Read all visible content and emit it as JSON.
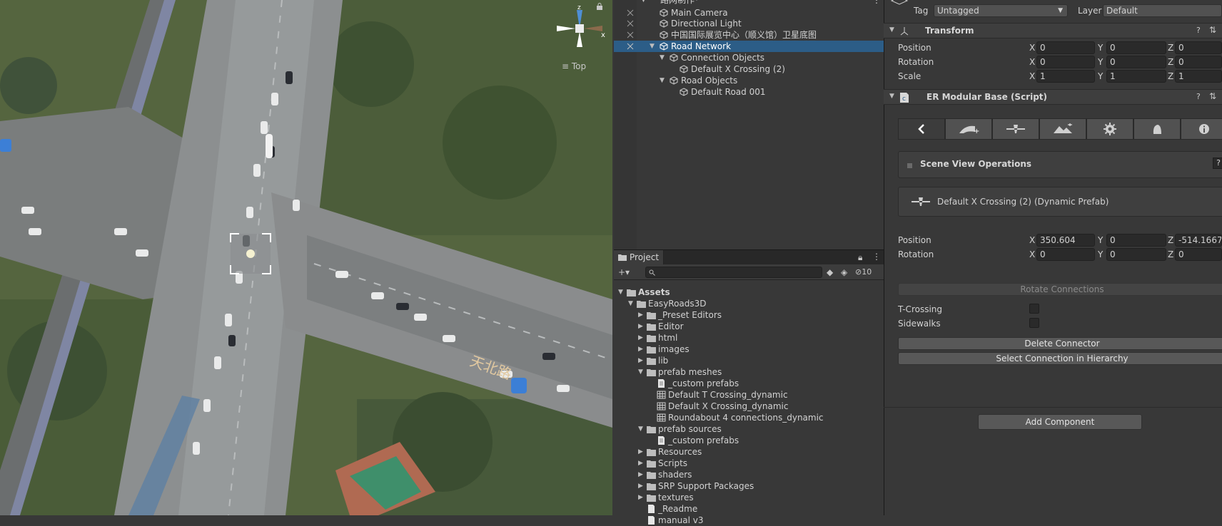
{
  "scene": {
    "gizmo_axes": {
      "z": "z",
      "x": "x"
    },
    "view_label": "Top",
    "map_text": "天北路"
  },
  "hierarchy": {
    "scene_name": "路网制作*",
    "items": [
      {
        "label": "Main Camera",
        "selected": false
      },
      {
        "label": "Directional Light",
        "selected": false
      },
      {
        "label": "中国国际展览中心（顺义馆）卫星底图",
        "selected": false
      },
      {
        "label": "Road Network",
        "selected": true
      },
      {
        "label": "Connection Objects",
        "selected": false
      },
      {
        "label": "Default X Crossing (2)",
        "selected": false
      },
      {
        "label": "Road Objects",
        "selected": false
      },
      {
        "label": "Default Road 001",
        "selected": false
      }
    ]
  },
  "project": {
    "tab_label": "Project",
    "add_label": "+▾",
    "hidden_count": "10",
    "items": [
      {
        "label": "Assets",
        "type": "folder",
        "bold": true
      },
      {
        "label": "EasyRoads3D",
        "type": "folder"
      },
      {
        "label": "_Preset Editors",
        "type": "folder"
      },
      {
        "label": "Editor",
        "type": "folder"
      },
      {
        "label": "html",
        "type": "folder"
      },
      {
        "label": "images",
        "type": "folder"
      },
      {
        "label": "lib",
        "type": "folder"
      },
      {
        "label": "prefab meshes",
        "type": "folder"
      },
      {
        "label": "_custom prefabs",
        "type": "file"
      },
      {
        "label": "Default T Crossing_dynamic",
        "type": "mesh"
      },
      {
        "label": "Default X Crossing_dynamic",
        "type": "mesh"
      },
      {
        "label": "Roundabout 4 connections_dynamic",
        "type": "mesh"
      },
      {
        "label": "prefab sources",
        "type": "folder"
      },
      {
        "label": "_custom prefabs",
        "type": "file"
      },
      {
        "label": "Resources",
        "type": "folder"
      },
      {
        "label": "Scripts",
        "type": "folder"
      },
      {
        "label": "shaders",
        "type": "folder"
      },
      {
        "label": "SRP Support Packages",
        "type": "folder"
      },
      {
        "label": "textures",
        "type": "folder"
      },
      {
        "label": "_Readme",
        "type": "file"
      },
      {
        "label": "manual v3",
        "type": "file"
      }
    ]
  },
  "inspector": {
    "tag_label": "Tag",
    "tag_value": "Untagged",
    "layer_label": "Layer",
    "layer_value": "Default",
    "transform": {
      "title": "Transform",
      "position_label": "Position",
      "rotation_label": "Rotation",
      "scale_label": "Scale",
      "position": {
        "x": "0",
        "y": "0",
        "z": "0"
      },
      "rotation": {
        "x": "0",
        "y": "0",
        "z": "0"
      },
      "scale": {
        "x": "1",
        "y": "1",
        "z": "1"
      }
    },
    "script": {
      "title": "ER Modular Base (Script)",
      "scene_ops_label": "Scene View Operations",
      "prefab_name": "Default X Crossing (2)",
      "prefab_type": "(Dynamic Prefab)",
      "position_label": "Position",
      "rotation_label": "Rotation",
      "position": {
        "x": "350.604",
        "y": "0",
        "z": "-514.1667"
      },
      "rotation": {
        "x": "0",
        "y": "0",
        "z": "0"
      },
      "rotate_connections": "Rotate Connections",
      "t_crossing_label": "T-Crossing",
      "sidewalks_label": "Sidewalks",
      "delete_connector": "Delete Connector",
      "select_connection": "Select Connection in Hierarchy"
    },
    "add_component": "Add Component",
    "axis": {
      "x": "X",
      "y": "Y",
      "z": "Z"
    },
    "help_glyph": "?",
    "options_glyph": "⇅"
  }
}
